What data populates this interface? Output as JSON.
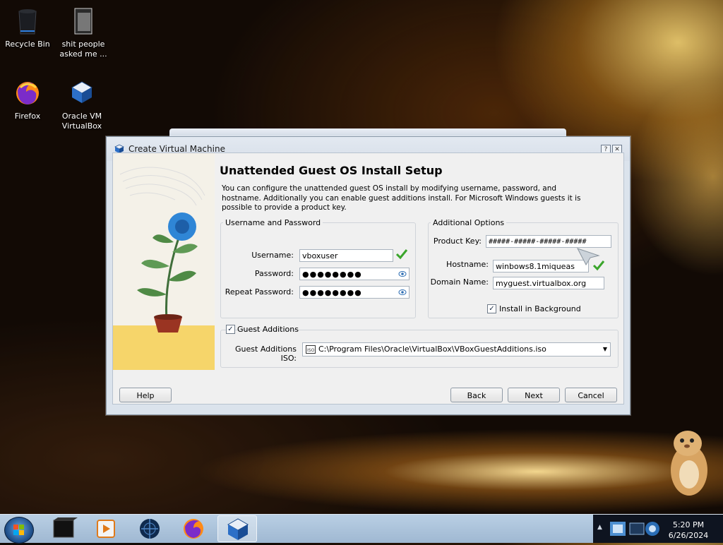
{
  "desktop": {
    "icons": [
      {
        "label": "Recycle Bin"
      },
      {
        "label": "shit people asked me ..."
      },
      {
        "label": "Firefox"
      },
      {
        "label": "Oracle VM VirtualBox"
      }
    ]
  },
  "dialog": {
    "title": "Create Virtual Machine",
    "help_glyph": "?",
    "close_glyph": "✕",
    "heading": "Unattended Guest OS Install Setup",
    "description": "You can configure the unattended guest OS install by modifying username, password, and hostname. Additionally you can enable guest additions install. For Microsoft Windows guests it is possible to provide a product key.",
    "username_password": {
      "group_title": "Username and Password",
      "username_label": "Username:",
      "username_value": "vboxuser",
      "password_label": "Password:",
      "password_value": "●●●●●●●●",
      "repeat_password_label": "Repeat Password:",
      "repeat_password_value": "●●●●●●●●"
    },
    "additional_options": {
      "group_title": "Additional Options",
      "product_key_label": "Product Key:",
      "product_key_value": "#####-#####-#####-#####",
      "hostname_label": "Hostname:",
      "hostname_value": "winbows8.1miqueas",
      "domain_name_label": "Domain Name:",
      "domain_name_value": "myguest.virtualbox.org",
      "install_in_background_label": "Install in Background",
      "install_in_background_checked": true
    },
    "guest_additions": {
      "checkbox_label": "Guest Additions",
      "checked": true,
      "iso_label": "Guest Additions ISO:",
      "iso_path": "C:\\Program Files\\Oracle\\VirtualBox\\VBoxGuestAdditions.iso"
    },
    "buttons": {
      "help": "Help",
      "back": "Back",
      "next": "Next",
      "cancel": "Cancel"
    }
  },
  "taskbar": {
    "items": [
      "start-button",
      "vm-app",
      "media-player",
      "globe-app",
      "firefox",
      "virtualbox"
    ],
    "tray_arrow": "▲",
    "clock_time": "5:20 PM",
    "clock_date": "6/26/2024"
  },
  "colors": {
    "accent_check": "#3aa52b",
    "titlebar": "#d7dfe9",
    "taskbar": "#a9c1db"
  }
}
